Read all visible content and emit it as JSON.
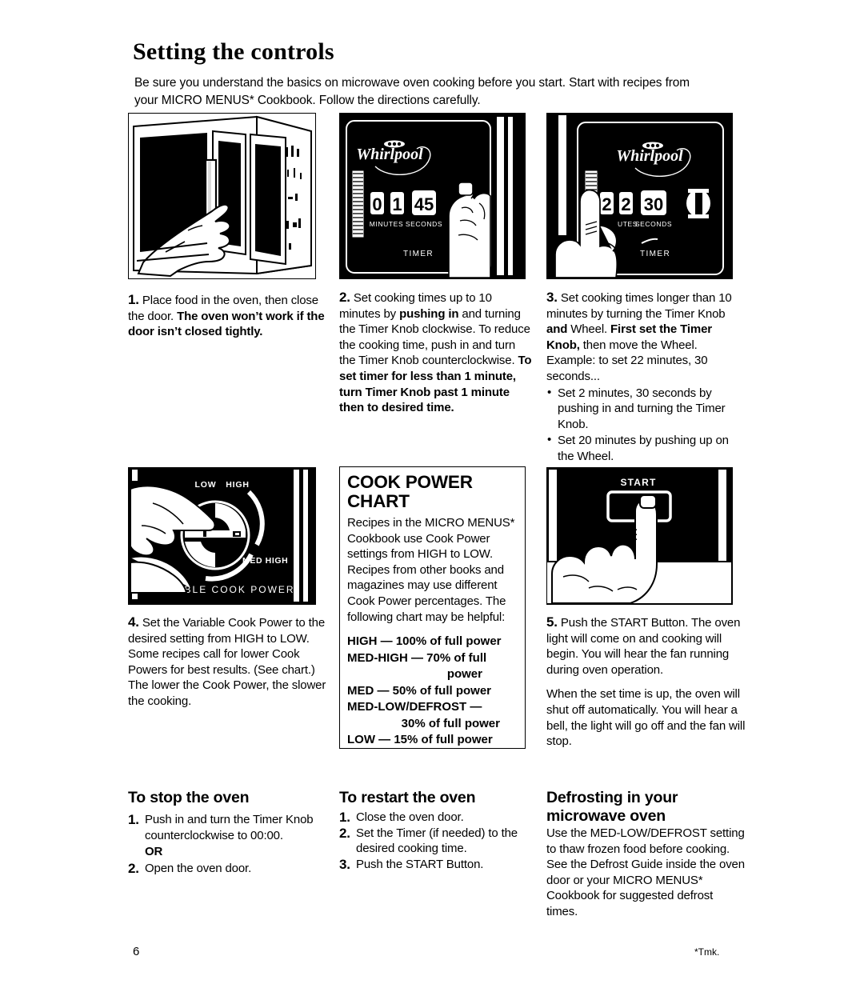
{
  "page": {
    "title": "Setting the controls",
    "intro": "Be sure you understand the basics on microwave oven cooking before you start. Start with recipes from your MICRO MENUS* Cookbook. Follow the directions carefully.",
    "page_number": "6",
    "trademark_note": "*Tmk."
  },
  "figures": {
    "fig1": {
      "caption_ref": "step1",
      "alt": "Hand opening microwave oven door"
    },
    "fig2": {
      "brand": "Whirlpool",
      "minutes_digit_1": "0",
      "minutes_digit_2": "1",
      "seconds": "45",
      "label_minutes": "MINUTES",
      "label_seconds": "SECONDS",
      "label_timer": "TIMER"
    },
    "fig3": {
      "brand": "Whirlpool",
      "minutes_digit_1": "2",
      "minutes_digit_2": "2",
      "seconds": "30",
      "label_minutes": "UTES",
      "label_seconds": "SECONDS",
      "label_timer": "TIMER"
    },
    "fig4": {
      "label_low": "LOW",
      "label_high": "HIGH",
      "label_med_high": "MED HIGH",
      "label_panel": "VARIABLE COOK POWER"
    },
    "fig5": {
      "label_start": "START"
    }
  },
  "steps": {
    "step1": {
      "number": "1.",
      "text_normal_1": "Place food in the oven, then close the door. ",
      "text_bold_1": "The oven won’t work if the door isn’t closed tightly."
    },
    "step2": {
      "number": "2.",
      "text_normal_1": "Set cooking times up to 10 minutes by ",
      "text_bold_1": "pushing in",
      "text_normal_2": " and turning the Timer Knob clockwise. To reduce the cooking time, push in and turn the Timer Knob counterclockwise. ",
      "text_bold_2": "To set timer for less than 1 minute, turn Timer Knob past 1 minute then to desired time."
    },
    "step3": {
      "number": "3.",
      "text_normal_1": "Set cooking times longer than 10 minutes by turning the Timer Knob ",
      "text_bold_1": "and",
      "text_normal_2": " Wheel. ",
      "text_bold_2": "First set the Timer Knob,",
      "text_normal_3": " then move the Wheel. Example: to set 22 minutes, 30 seconds...",
      "bullets": [
        "Set 2 minutes, 30 seconds by pushing in and turning the Timer Knob.",
        "Set 20 minutes by pushing up on the Wheel."
      ]
    },
    "step4": {
      "number": "4.",
      "text": "Set the Variable Cook Power to the desired setting from HIGH to LOW. Some recipes call for lower Cook Powers for best results. (See chart.) The lower the Cook Power, the slower the cooking."
    },
    "step5": {
      "number": "5.",
      "paragraph_1": "Push the START Button. The oven light will come on and cooking will begin. You will hear the fan running during oven operation.",
      "paragraph_2": "When the set time is up, the oven will shut off automatically. You will hear a bell, the light will go off and the fan will stop."
    }
  },
  "cook_power_chart": {
    "title_line_1": "COOK POWER",
    "title_line_2": "CHART",
    "body": "Recipes in the MICRO MENUS* Cookbook use Cook Power settings from HIGH to LOW. Recipes from other books and magazines may use different Cook Power percentages. The following chart may be helpful:",
    "rows": [
      {
        "setting": "HIGH — 100% of full power",
        "continuation": ""
      },
      {
        "setting": "MED-HIGH — 70% of full",
        "continuation": "power"
      },
      {
        "setting": "MED — 50% of full power",
        "continuation": ""
      },
      {
        "setting": "MED-LOW/DEFROST —",
        "continuation": "30% of full power"
      },
      {
        "setting": "LOW — 15% of full power",
        "continuation": ""
      }
    ]
  },
  "sections": {
    "stop_oven": {
      "heading": "To stop the oven",
      "items": [
        {
          "number": "1.",
          "text": "Push in and turn the Timer Knob counterclockwise to 00:00."
        },
        {
          "number": "",
          "text": "OR"
        },
        {
          "number": "2.",
          "text": "Open the oven door."
        }
      ]
    },
    "restart_oven": {
      "heading": "To restart the oven",
      "items": [
        {
          "number": "1.",
          "text": "Close the oven door."
        },
        {
          "number": "2.",
          "text": "Set the Timer (if needed) to the desired cooking time."
        },
        {
          "number": "3.",
          "text": "Push the START Button."
        }
      ]
    },
    "defrosting": {
      "heading_line_1": "Defrosting in your",
      "heading_line_2": "microwave oven",
      "body": "Use the MED-LOW/DEFROST setting to thaw frozen food before cooking. See the Defrost Guide inside the oven door or your MICRO MENUS* Cookbook for suggested defrost times."
    }
  },
  "colors": {
    "ink": "#000000",
    "paper": "#ffffff"
  }
}
